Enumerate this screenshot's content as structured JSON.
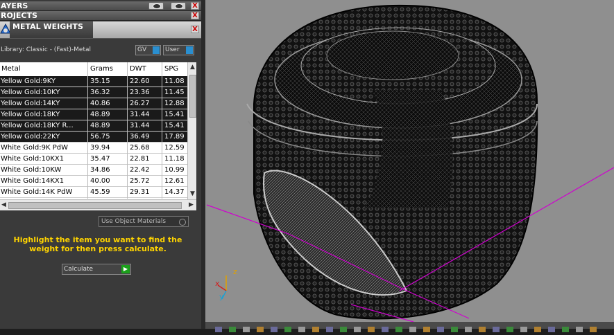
{
  "panels": {
    "layers": {
      "title": "AYERS",
      "close": "X"
    },
    "projects": {
      "title": "ROJECTS",
      "close": "X"
    },
    "metal_weights": {
      "title": "METAL WEIGHTS",
      "close": "X"
    }
  },
  "library_label": "Library: Classic - (Fast)-Metal",
  "toggles": {
    "gv": "GV",
    "user": "User"
  },
  "table": {
    "headers": [
      "Metal",
      "Grams",
      "DWT",
      "SPG"
    ],
    "rows": [
      [
        "Yellow Gold:9KY",
        "35.15",
        "22.60",
        "11.08"
      ],
      [
        "Yellow Gold:10KY",
        "36.32",
        "23.36",
        "11.45"
      ],
      [
        "Yellow Gold:14KY",
        "40.86",
        "26.27",
        "12.88"
      ],
      [
        "Yellow Gold:18KY",
        "48.89",
        "31.44",
        "15.41"
      ],
      [
        "Yellow Gold:18KY R...",
        "48.89",
        "31.44",
        "15.41"
      ],
      [
        "Yellow Gold:22KY",
        "56.75",
        "36.49",
        "17.89"
      ],
      [
        "White Gold:9K PdW",
        "39.94",
        "25.68",
        "12.59"
      ],
      [
        "White Gold:10KX1",
        "35.47",
        "22.81",
        "11.18"
      ],
      [
        "White Gold:10KW",
        "34.86",
        "22.42",
        "10.99"
      ],
      [
        "White Gold:14KX1",
        "40.00",
        "25.72",
        "12.61"
      ],
      [
        "White Gold:14K PdW",
        "45.59",
        "29.31",
        "14.37"
      ]
    ],
    "selected_rows": 6
  },
  "use_object_materials": "Use Object Materials",
  "hint": "Highlight the item you want to find the weight for then press calculate.",
  "calculate_label": "Calculate",
  "axis": {
    "x": "x",
    "y": "y",
    "z": "z"
  },
  "colors": {
    "hint": "#ffd400",
    "axis_line": "#d000d0",
    "selection": "#1a1a1a"
  }
}
